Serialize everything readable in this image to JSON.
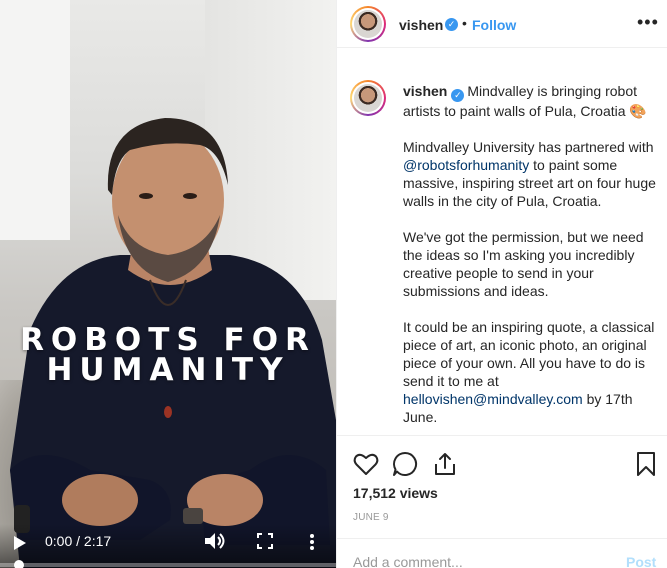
{
  "video": {
    "overlay_line1": "ROBOTS FOR",
    "overlay_line2": "HUMANITY",
    "current_time": "0:00",
    "duration": "2:17",
    "time_display": "0:00 / 2:17",
    "progress_fraction": 0
  },
  "header": {
    "username": "vishen",
    "separator": "•",
    "follow_label": "Follow",
    "more_icon": "more-horizontal-icon"
  },
  "caption": {
    "username": "vishen",
    "headline": "Mindvalley is bringing robot artists to paint walls of Pula, Croatia 🎨",
    "p2_before": "Mindvalley University has partnered with ",
    "p2_mention": "@robotsforhumanity",
    "p2_after": " to paint some massive, inspiring street art on four huge walls in the city of Pula, Croatia.",
    "p3": "We've got the permission, but we need the ideas so I'm asking you incredibly creative people to send in your submissions and ideas.",
    "p4_before": "It could be an inspiring quote, a classical piece of art, an iconic photo, an original piece of your own. All you have to do is send it to me at ",
    "p4_email": "hellovishen@mindvalley.com",
    "p4_after": " by 17th June."
  },
  "actions": {
    "views": "17,512 views",
    "date": "JUNE 9",
    "comment_placeholder": "Add a comment...",
    "post_label": "Post"
  },
  "colors": {
    "accent": "#3897f0",
    "link": "#003569",
    "muted": "#999999",
    "post_disabled": "#b2dffc"
  }
}
